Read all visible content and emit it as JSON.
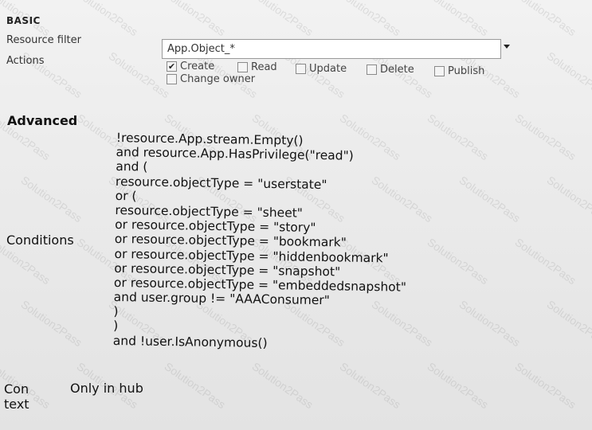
{
  "basic": {
    "heading": "BASIC",
    "resource_filter_label": "Resource filter",
    "resource_filter_value": "App.Object_*",
    "actions_label": "Actions",
    "actions": [
      {
        "label": "Create",
        "checked": true
      },
      {
        "label": "Read",
        "checked": false
      },
      {
        "label": "Update",
        "checked": false
      },
      {
        "label": "Delete",
        "checked": false
      },
      {
        "label": "Publish",
        "checked": false
      },
      {
        "label": "Change owner",
        "checked": false
      }
    ]
  },
  "advanced": {
    "heading": "Advanced",
    "conditions_label": "Conditions",
    "conditions_lines": [
      "!resource.App.stream.Empty()",
      "and resource.App.HasPrivilege(\"read\")",
      "and (",
      "resource.objectType = \"userstate\"",
      "or (",
      "resource.objectType = \"sheet\"",
      "or resource.objectType = \"story\"",
      "or resource.objectType = \"bookmark\"",
      "or resource.objectType = \"hiddenbookmark\"",
      "or resource.objectType = \"snapshot\"",
      "or resource.objectType = \"embeddedsnapshot\"",
      "and user.group != \"AAAConsumer\"",
      ")",
      ")",
      "and !user.IsAnonymous()"
    ],
    "context_label_line1": "Con",
    "context_label_line2": "text",
    "context_value": "Only in hub"
  },
  "watermark": "Solution2Pass",
  "icons": {
    "dropdown": "chevron-down-icon",
    "checkbox_checked": "checkmark-icon"
  }
}
